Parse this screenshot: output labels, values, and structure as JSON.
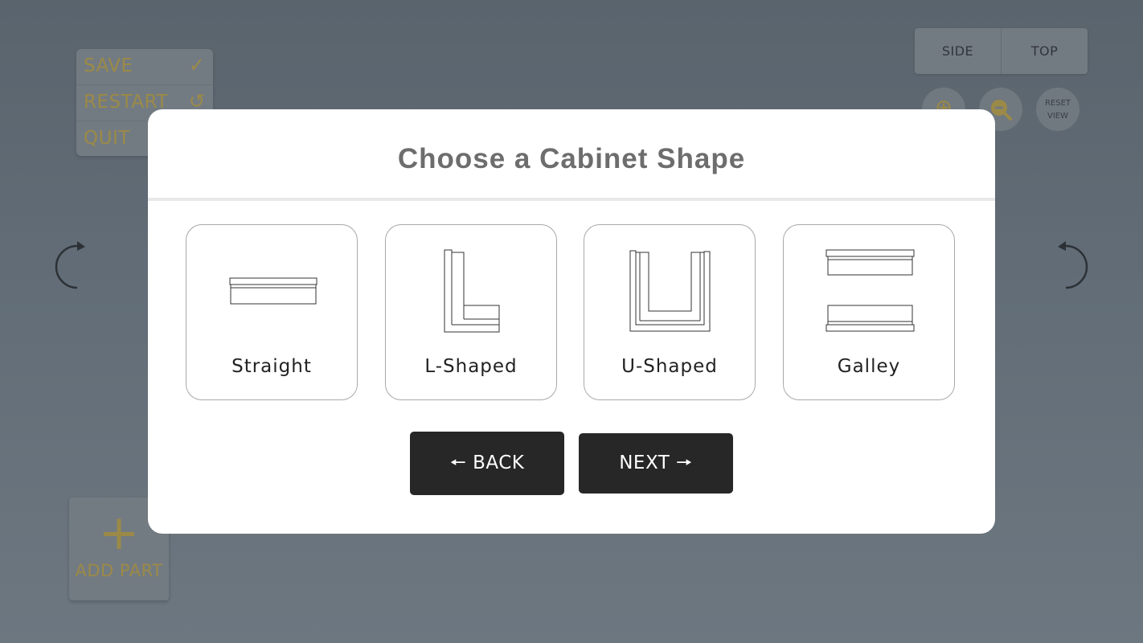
{
  "background": {
    "menu": {
      "save_label": "SAVE",
      "save_icon": "check-icon",
      "restart_label": "RESTART",
      "restart_icon": "undo-icon",
      "quit_label": "QUIT"
    },
    "view_toggle": {
      "side_label": "SIDE",
      "top_label": "TOP"
    },
    "zoom": {
      "zoom_in_icon": "zoom-in-icon",
      "zoom_out_icon": "zoom-out-icon",
      "reset_line1": "RESET",
      "reset_line2": "VIEW"
    },
    "rotate": {
      "left_icon": "rotate-left-icon",
      "right_icon": "rotate-right-icon"
    },
    "add_part": {
      "label": "ADD PART",
      "icon": "plus-icon"
    }
  },
  "modal": {
    "title": "Choose a Cabinet Shape",
    "shapes": [
      {
        "label": "Straight",
        "icon": "straight-cabinet-icon"
      },
      {
        "label": "L-Shaped",
        "icon": "l-shaped-cabinet-icon"
      },
      {
        "label": "U-Shaped",
        "icon": "u-shaped-cabinet-icon"
      },
      {
        "label": "Galley",
        "icon": "galley-cabinet-icon"
      }
    ],
    "back_label": "🠔 BACK",
    "next_label": "NEXT 🠖"
  },
  "colors": {
    "accent_gold": "#9b8a47",
    "overlay_bg": "#626d77",
    "button_dark": "#272727",
    "title_gray": "#6d6d6d"
  }
}
